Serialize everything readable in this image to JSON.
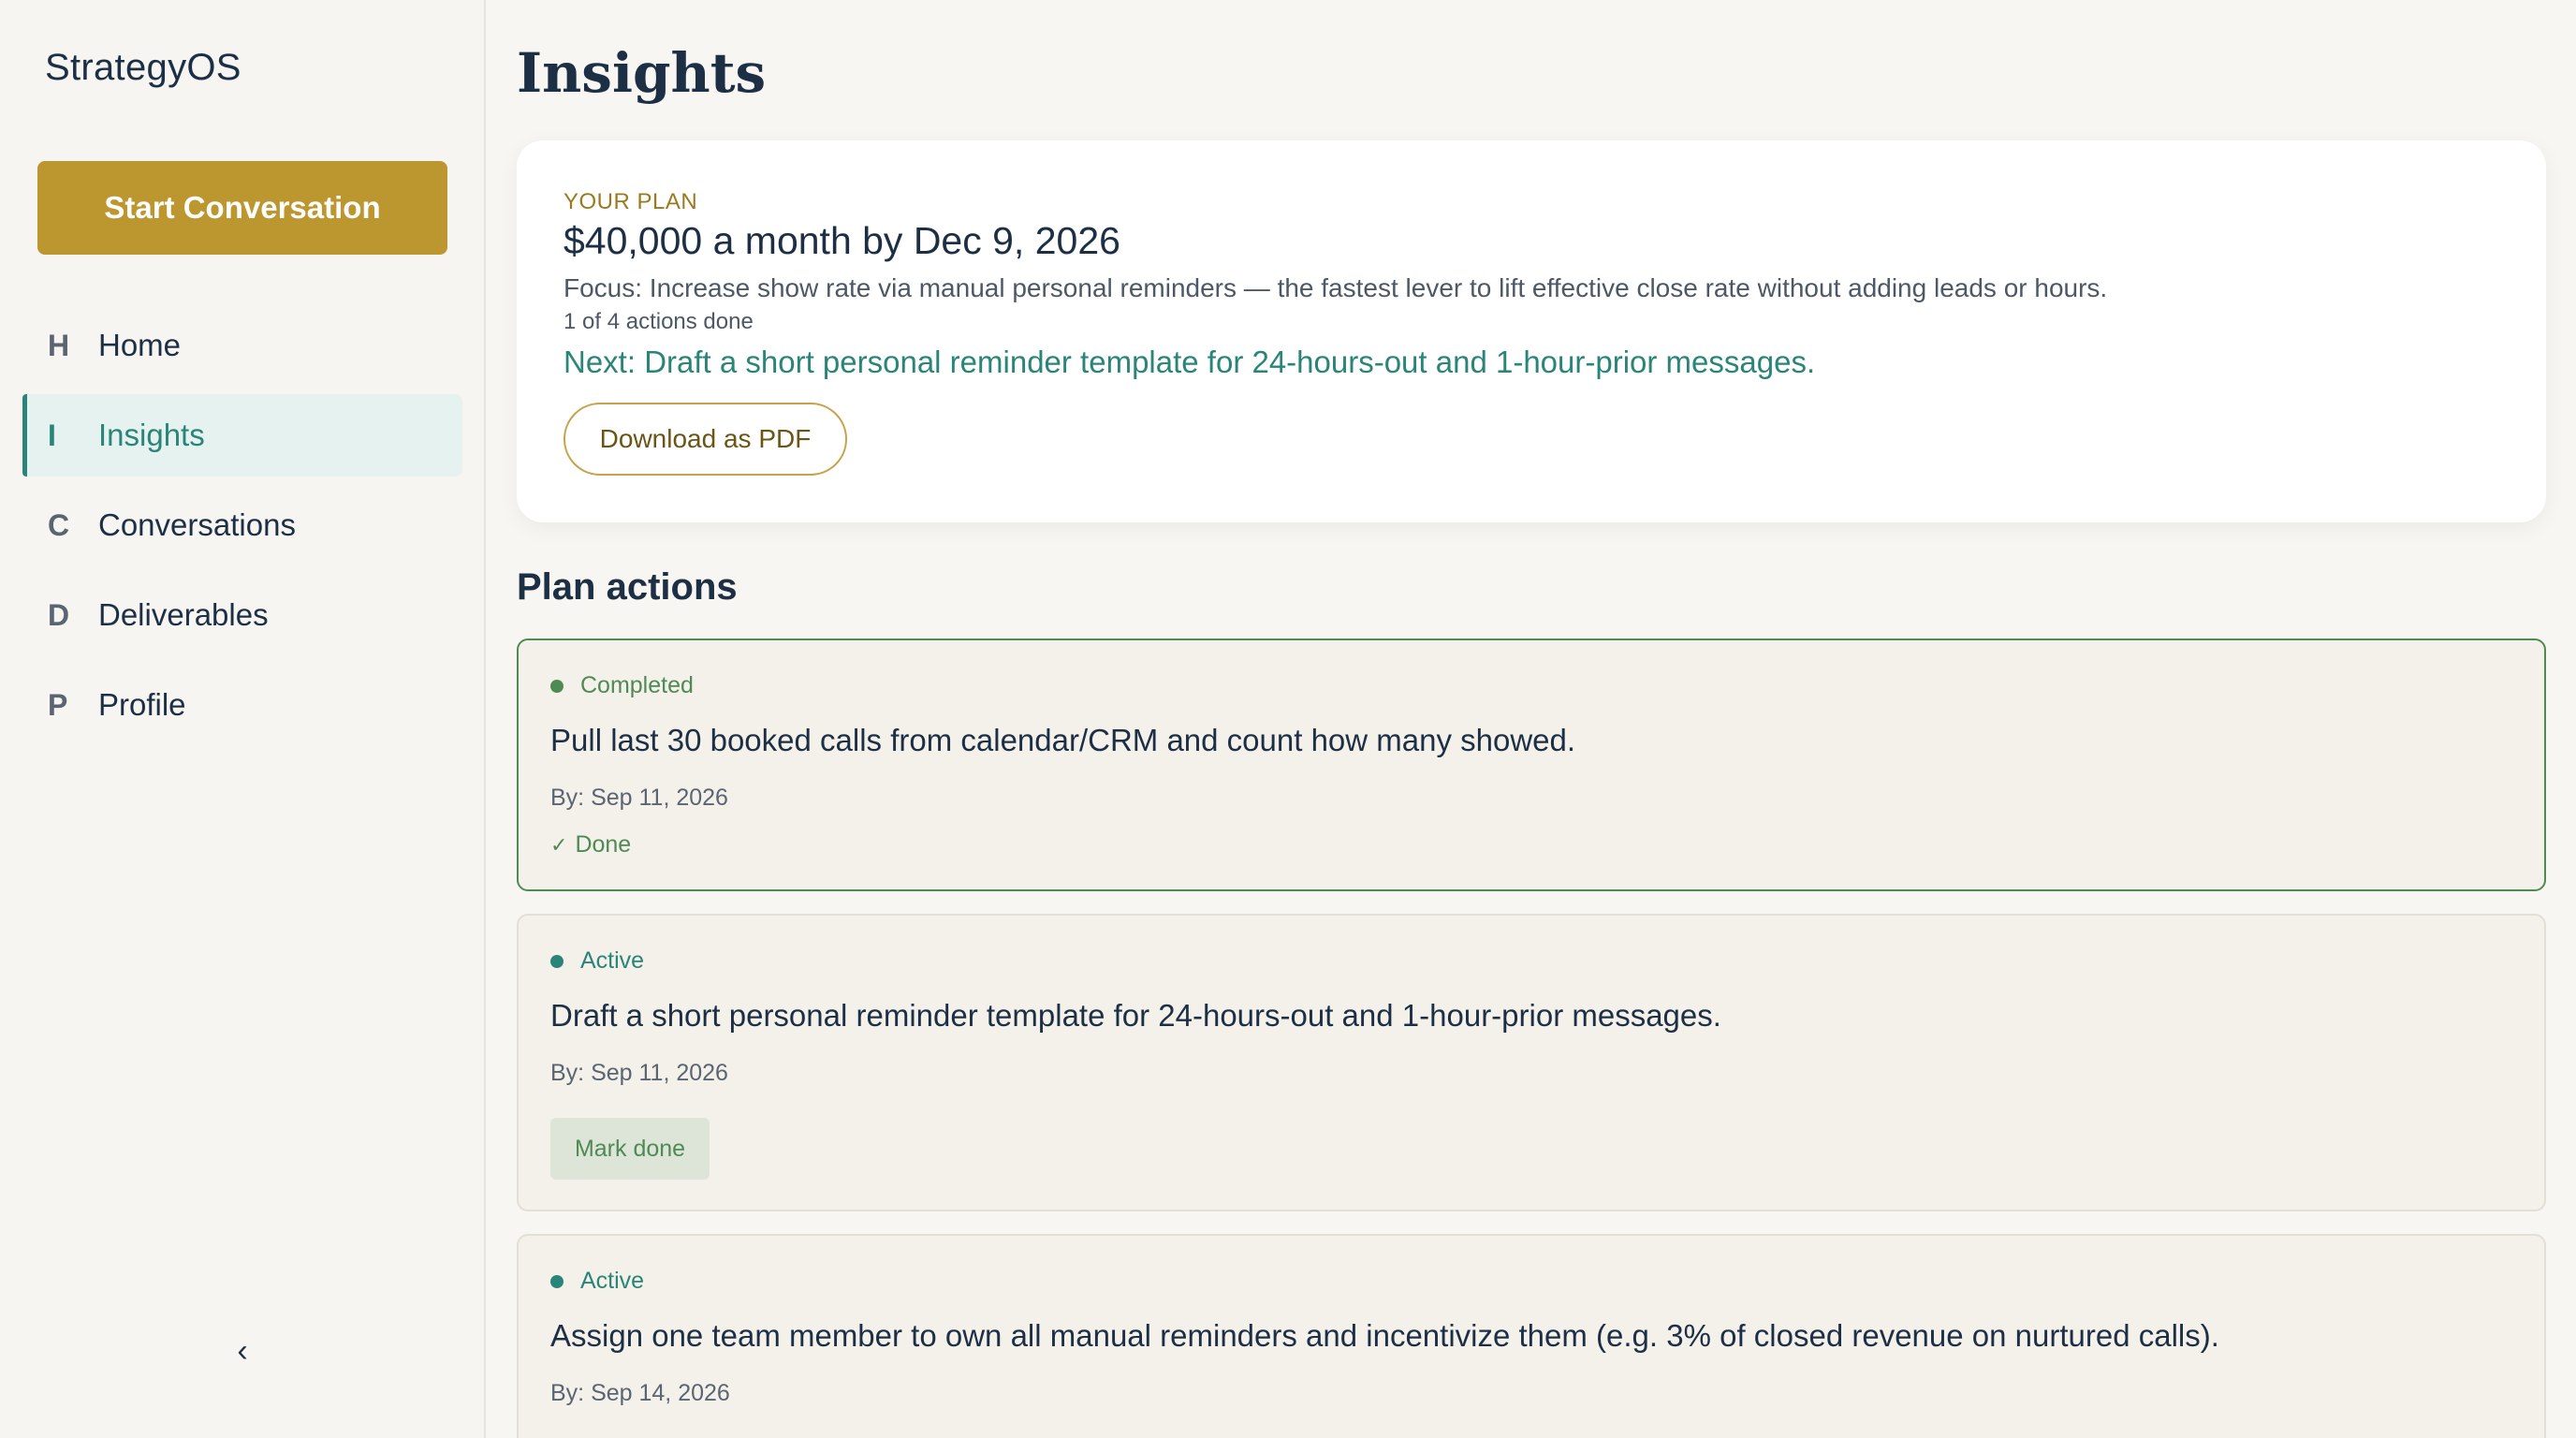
{
  "app": {
    "name": "StrategyOS"
  },
  "sidebar": {
    "cta_label": "Start Conversation",
    "items": [
      {
        "letter": "H",
        "label": "Home",
        "active": false
      },
      {
        "letter": "I",
        "label": "Insights",
        "active": true
      },
      {
        "letter": "C",
        "label": "Conversations",
        "active": false
      },
      {
        "letter": "D",
        "label": "Deliverables",
        "active": false
      },
      {
        "letter": "P",
        "label": "Profile",
        "active": false
      }
    ],
    "collapse_icon": "‹"
  },
  "page": {
    "title": "Insights"
  },
  "plan": {
    "eyebrow": "YOUR PLAN",
    "goal": "$40,000 a month by Dec 9, 2026",
    "focus": "Focus: Increase show rate via manual personal reminders — the fastest lever to lift effective close rate without adding leads or hours.",
    "progress": "1 of 4 actions done",
    "next": "Next: Draft a short personal reminder template for 24-hours-out and 1-hour-prior messages.",
    "download_label": "Download as PDF"
  },
  "actions_section": {
    "title": "Plan actions",
    "items": [
      {
        "status": "Completed",
        "title": "Pull last 30 booked calls from calendar/CRM and count how many showed.",
        "due": "By: Sep 11, 2026",
        "done_label": "Done"
      },
      {
        "status": "Active",
        "title": "Draft a short personal reminder template for 24-hours-out and 1-hour-prior messages.",
        "due": "By: Sep 11, 2026",
        "button_label": "Mark done"
      },
      {
        "status": "Active",
        "title": "Assign one team member to own all manual reminders and incentivize them (e.g. 3% of closed revenue on nurtured calls).",
        "due": "By: Sep 14, 2026"
      }
    ]
  },
  "colors": {
    "brand_gold": "#bc962e",
    "accent_teal": "#2a8578",
    "done_green": "#4f8a55",
    "text_navy": "#1d2f45",
    "background": "#f8f6f2"
  },
  "icons": {
    "done": "check-icon",
    "collapse": "chevron-left-icon"
  }
}
